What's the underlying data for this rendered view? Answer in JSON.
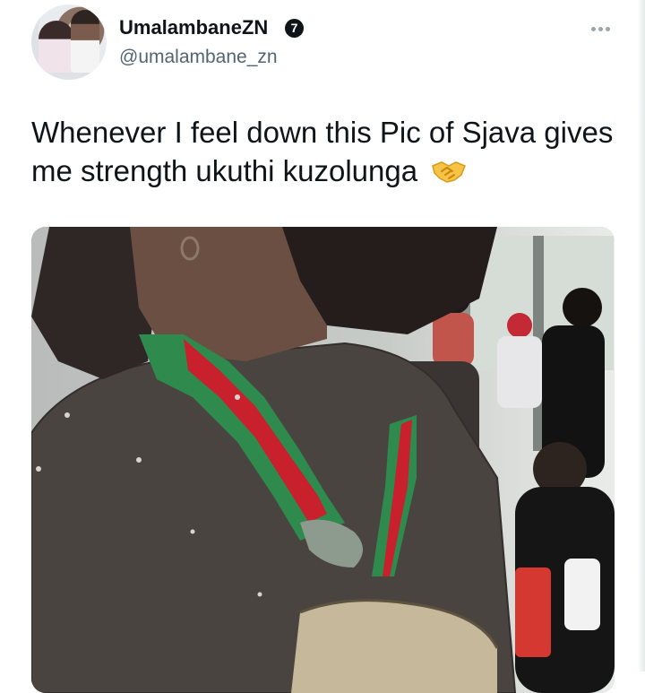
{
  "tweet": {
    "display_name": "UmalambaneZN",
    "verified_badge": "7",
    "handle": "@umalambane_zn",
    "text": "Whenever I feel down this Pic of Sjava gives me strength ukuthi kuzolunga",
    "emoji": "handshake-icon",
    "media_description_icon": "photo-icon"
  },
  "colors": {
    "text": "#0f1419",
    "secondary": "#536471",
    "ribbon_green": "#2f8a4e",
    "ribbon_red": "#c8202c"
  }
}
